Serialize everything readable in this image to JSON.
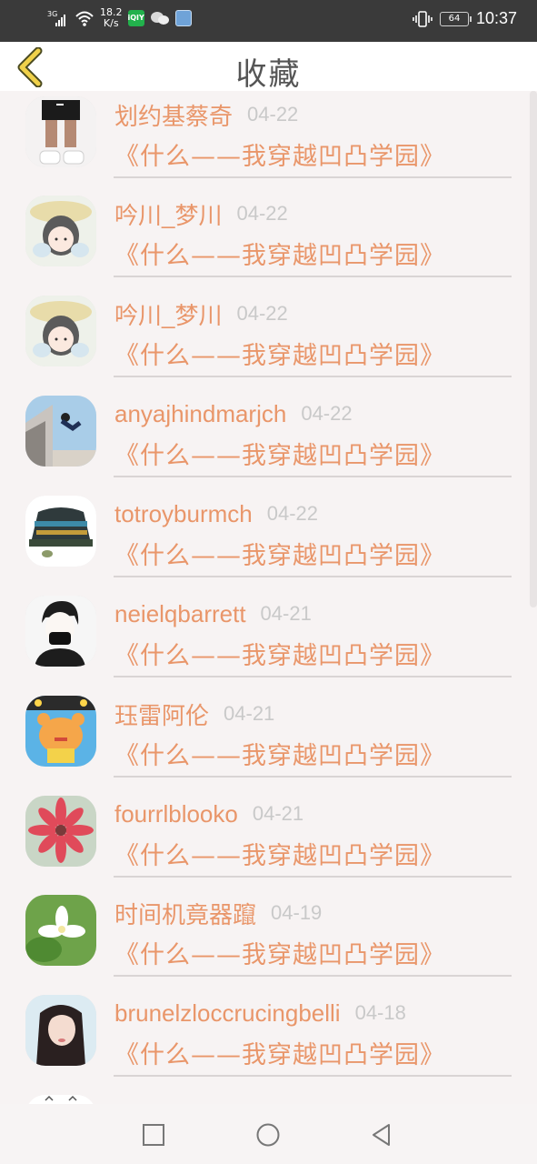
{
  "status_bar": {
    "network_tag": "3G",
    "speed_value": "18.2",
    "speed_unit": "K/s",
    "iqiyi_label": "iQIY",
    "battery": "64",
    "time": "10:37"
  },
  "header": {
    "title": "收藏"
  },
  "list": {
    "items": [
      {
        "name": "划约基蔡奇",
        "date": "04-22",
        "book": "《什么——我穿越凹凸学园》"
      },
      {
        "name": "吟川_梦川",
        "date": "04-22",
        "book": "《什么——我穿越凹凸学园》"
      },
      {
        "name": "吟川_梦川",
        "date": "04-22",
        "book": "《什么——我穿越凹凸学园》"
      },
      {
        "name": "anyajhindmarjch",
        "date": "04-22",
        "book": "《什么——我穿越凹凸学园》"
      },
      {
        "name": "totroyburmch",
        "date": "04-22",
        "book": "《什么——我穿越凹凸学园》"
      },
      {
        "name": "neielqbarrett",
        "date": "04-21",
        "book": "《什么——我穿越凹凸学园》"
      },
      {
        "name": "珏雷阿伦",
        "date": "04-21",
        "book": "《什么——我穿越凹凸学园》"
      },
      {
        "name": "fourrlblooko",
        "date": "04-21",
        "book": "《什么——我穿越凹凸学园》"
      },
      {
        "name": "时间机竟器躥",
        "date": "04-19",
        "book": "《什么——我穿越凹凸学园》"
      },
      {
        "name": "brunelzloccrucingbelli",
        "date": "04-18",
        "book": "《什么——我穿越凹凸学园》"
      }
    ]
  },
  "colors": {
    "accent": "#e9966a",
    "date": "#c9c9c9",
    "title": "#555555",
    "status_bar": "#3a3a3a"
  }
}
